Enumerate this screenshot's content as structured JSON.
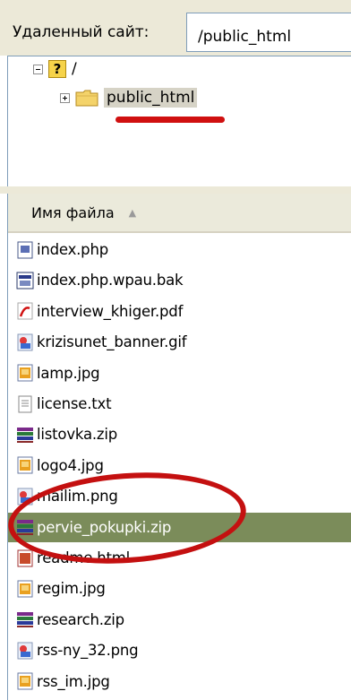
{
  "remote": {
    "label": "Удаленный сайт:",
    "path": "/public_html"
  },
  "tree": {
    "root_label": "/",
    "child_label": "public_html"
  },
  "file_list": {
    "column_header": "Имя файла",
    "sort_indicator": "▲",
    "files": [
      {
        "name": "index.php",
        "icon": "php-file-icon"
      },
      {
        "name": "index.php.wpau.bak",
        "icon": "bak-file-icon"
      },
      {
        "name": "interview_khiger.pdf",
        "icon": "pdf-file-icon"
      },
      {
        "name": "krizisunet_banner.gif",
        "icon": "image-file-icon"
      },
      {
        "name": "lamp.jpg",
        "icon": "jpg-file-icon"
      },
      {
        "name": "license.txt",
        "icon": "text-file-icon"
      },
      {
        "name": "listovka.zip",
        "icon": "archive-file-icon"
      },
      {
        "name": "logo4.jpg",
        "icon": "jpg-file-icon"
      },
      {
        "name": "mailim.png",
        "icon": "image-file-icon"
      },
      {
        "name": "pervie_pokupki.zip",
        "icon": "archive-file-icon",
        "selected": true
      },
      {
        "name": "readme.html",
        "icon": "html-file-icon"
      },
      {
        "name": "regim.jpg",
        "icon": "jpg-file-icon"
      },
      {
        "name": "research.zip",
        "icon": "archive-file-icon"
      },
      {
        "name": "rss-ny_32.png",
        "icon": "image-file-icon"
      },
      {
        "name": "rss_im.jpg",
        "icon": "jpg-file-icon"
      }
    ]
  },
  "colors": {
    "selection": "#7b8c5a",
    "annotation": "#c41010",
    "panel": "#ece9d8"
  }
}
